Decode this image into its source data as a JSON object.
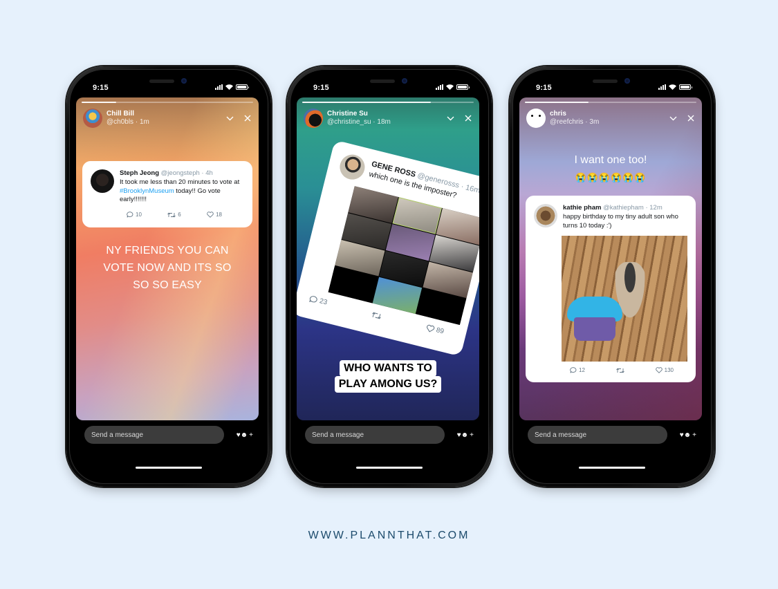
{
  "footer": {
    "url": "WWW.PLANNTHAT.COM"
  },
  "colors": {
    "background": "#e6f1fc",
    "footer_text": "#1b4a6b",
    "hashtag": "#1da1f2",
    "message_bar": "#3c3c3c"
  },
  "phones": [
    {
      "status": {
        "time": "9:15"
      },
      "progress": 0.2,
      "story": {
        "name": "Chill Bill",
        "handle": "@ch0bls · 1m"
      },
      "tweet": {
        "name": "Steph Jeong",
        "handle": "@jeongsteph · 4h",
        "text_before": "It took me less than 20 minutes to vote at ",
        "hashtag": "#BrooklynMuseum",
        "text_after": " today!! Go vote early!!!!!!!",
        "replies": "10",
        "retweets": "6",
        "likes": "18"
      },
      "story_text_lines": [
        "NY FRIENDS YOU CAN",
        "VOTE NOW AND ITS SO",
        "SO SO EASY"
      ],
      "message_placeholder": "Send a message",
      "react_plus": "+"
    },
    {
      "status": {
        "time": "9:15"
      },
      "progress": 0.75,
      "story": {
        "name": "Christine Su",
        "handle": "@christine_su · 18m"
      },
      "tweet": {
        "name": "GENE ROSS",
        "handle": "@generosss · 16m",
        "text": "which one is the imposter?",
        "replies": "23",
        "retweets": "",
        "likes": "89"
      },
      "caption_lines": [
        "WHO WANTS TO",
        "PLAY AMONG US?"
      ],
      "message_placeholder": "Send a message",
      "react_plus": "+"
    },
    {
      "status": {
        "time": "9:15"
      },
      "progress": 0.37,
      "story": {
        "name": "chris",
        "handle": "@reefchris · 3m"
      },
      "story_text": "I want one too!",
      "emojis": "😭😭😭😭😭😭",
      "tweet": {
        "name": "kathie pham",
        "handle": "@kathiepham · 12m",
        "text": "happy birthday to my tiny adult son who turns 10 today :')",
        "replies": "12",
        "retweets": "",
        "likes": "130"
      },
      "message_placeholder": "Send a message",
      "react_plus": "+"
    }
  ]
}
